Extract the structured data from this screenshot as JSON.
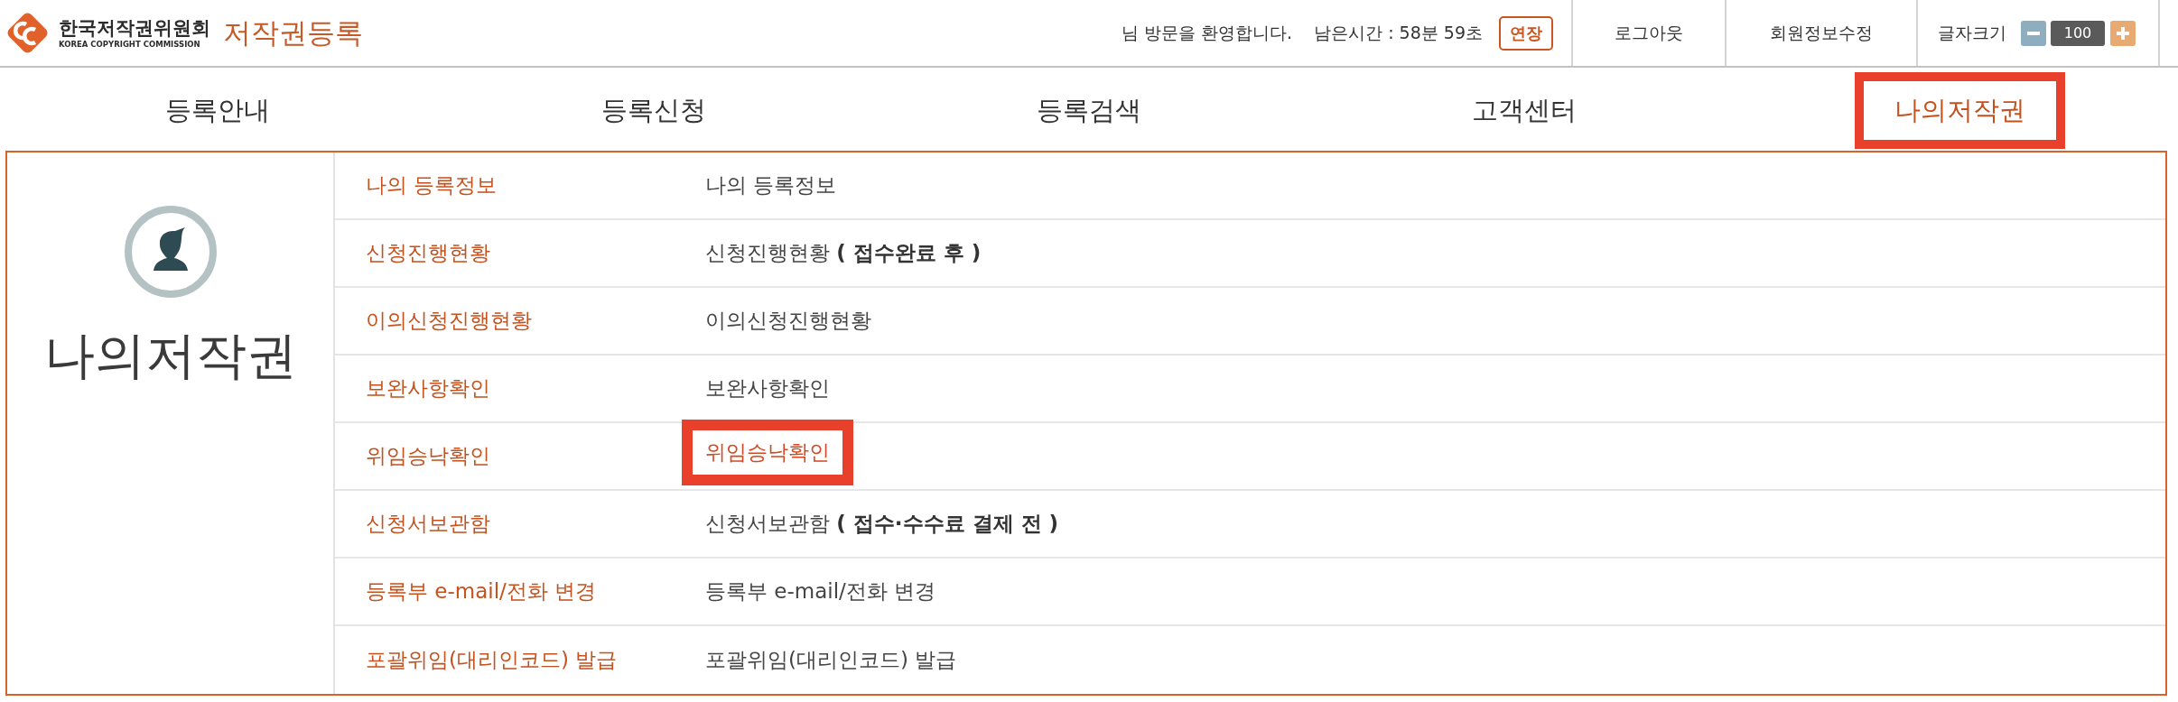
{
  "header": {
    "logo": {
      "title": "한국저작권위원회",
      "subtitle": "KOREA COPYRIGHT COMMISSION"
    },
    "site_title": "저작권등록",
    "welcome": "님 방문을 환영합니다.",
    "remaining_time": "남은시간 : 58분 59초",
    "extend_button": "연장",
    "links": [
      "로그아웃",
      "회원정보수정"
    ],
    "font_size": {
      "label": "글자크기",
      "value": "100"
    }
  },
  "nav": [
    {
      "label": "등록안내",
      "selected": false,
      "highlighted": false
    },
    {
      "label": "등록신청",
      "selected": false,
      "highlighted": false
    },
    {
      "label": "등록검색",
      "selected": false,
      "highlighted": false
    },
    {
      "label": "고객센터",
      "selected": false,
      "highlighted": false
    },
    {
      "label": "나의저작권",
      "selected": true,
      "highlighted": true
    }
  ],
  "side_panel": {
    "title": "나의저작권"
  },
  "menu": [
    {
      "label": "나의 등록정보",
      "link": "나의 등록정보",
      "highlighted": false
    },
    {
      "label": "신청진행현황",
      "link": "신청진행현황 **( 접수완료 후 )**",
      "highlighted": false
    },
    {
      "label": "이의신청진행현황",
      "link": "이의신청진행현황",
      "highlighted": false
    },
    {
      "label": "보완사항확인",
      "link": "보완사항확인",
      "highlighted": false
    },
    {
      "label": "위임승낙확인",
      "link": "위임승낙확인",
      "highlighted": true
    },
    {
      "label": "신청서보관함",
      "link": "신청서보관함 **( 접수·수수료 결제 전 )**",
      "highlighted": false
    },
    {
      "label": "등록부 e-mail/전화 변경",
      "link": "등록부 e-mail/전화 변경",
      "highlighted": false
    },
    {
      "label": "포괄위임(대리인코드) 발급",
      "link": "포괄위임(대리인코드) 발급",
      "highlighted": false
    }
  ]
}
